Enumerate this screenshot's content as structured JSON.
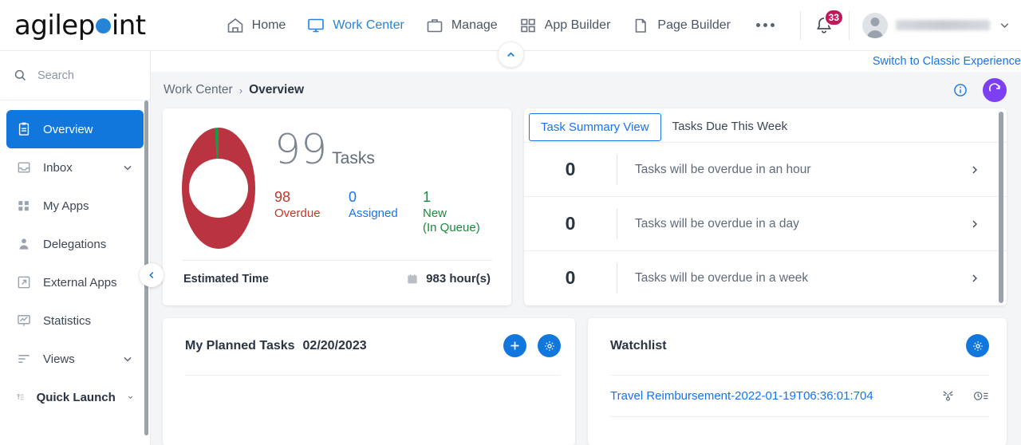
{
  "header": {
    "logo_text_pre": "agilep",
    "logo_text_post": "int",
    "logo_icon": "blue-dot",
    "nav": [
      {
        "label": "Home",
        "icon": "home-icon",
        "active": false
      },
      {
        "label": "Work Center",
        "icon": "monitor-icon",
        "active": true
      },
      {
        "label": "Manage",
        "icon": "briefcase-icon",
        "active": false
      },
      {
        "label": "App Builder",
        "icon": "grid-icon",
        "active": false
      },
      {
        "label": "Page Builder",
        "icon": "pages-icon",
        "active": false
      }
    ],
    "more_icon": "ellipsis-icon",
    "notification": {
      "icon": "bell-icon",
      "count": "33"
    },
    "user": {
      "avatar_icon": "avatar-icon",
      "name": "",
      "caret_icon": "chevron-down-icon"
    },
    "collapse_icon": "chevron-up-icon"
  },
  "sidebar": {
    "search": {
      "placeholder": "Search",
      "icon": "search-icon"
    },
    "items": [
      {
        "label": "Overview",
        "icon": "clipboard-icon",
        "active": true,
        "chevron": false
      },
      {
        "label": "Inbox",
        "icon": "inbox-icon",
        "active": false,
        "chevron": true
      },
      {
        "label": "My Apps",
        "icon": "apps-grid-icon",
        "active": false,
        "chevron": false
      },
      {
        "label": "Delegations",
        "icon": "person-icon",
        "active": false,
        "chevron": false
      },
      {
        "label": "External Apps",
        "icon": "external-link-icon",
        "active": false,
        "chevron": false
      },
      {
        "label": "Statistics",
        "icon": "chart-icon",
        "active": false,
        "chevron": false
      },
      {
        "label": "Views",
        "icon": "list-lines-icon",
        "active": false,
        "chevron": true
      },
      {
        "label": "Quick Launch",
        "icon": "quick-launch-icon",
        "active": false,
        "chevron": true
      }
    ],
    "collapse_icon": "chevron-left-icon"
  },
  "topbar": {
    "switch_link": "Switch to Classic Experience",
    "info_icon": "info-icon",
    "refresh_icon": "refresh-icon"
  },
  "breadcrumb": {
    "root": "Work Center",
    "separator": "›",
    "current": "Overview"
  },
  "tasks_card": {
    "total": "99",
    "total_label": "Tasks",
    "stats": [
      {
        "value": "98",
        "label": "Overdue",
        "color": "#c0392b"
      },
      {
        "value": "0",
        "label": "Assigned",
        "color": "#1a73e8"
      },
      {
        "value": "1",
        "label": "New\n(In Queue)",
        "color": "#188a3e"
      }
    ],
    "estimated_time_label": "Estimated Time",
    "estimated_time_value": "983 hour(s)",
    "estimated_time_icon": "calendar-icon"
  },
  "chart_data": {
    "type": "pie",
    "title": "Tasks",
    "categories": [
      "Overdue",
      "Assigned",
      "New (In Queue)"
    ],
    "values": [
      98,
      0,
      1
    ],
    "colors": [
      "#b93340",
      "#1a73e8",
      "#159b43"
    ],
    "total": 99,
    "legend": "right",
    "donut": true
  },
  "summary_card": {
    "tabs": [
      {
        "label": "Task Summary View",
        "active": true
      },
      {
        "label": "Tasks Due This Week",
        "active": false
      }
    ],
    "rows": [
      {
        "count": "0",
        "text": "Tasks will be overdue in an hour",
        "chevron": "chevron-right-icon"
      },
      {
        "count": "0",
        "text": "Tasks will be overdue in a day",
        "chevron": "chevron-right-icon"
      },
      {
        "count": "0",
        "text": "Tasks will be overdue in a week",
        "chevron": "chevron-right-icon"
      }
    ]
  },
  "planned_card": {
    "title": "My Planned Tasks",
    "date": "02/20/2023",
    "add_icon": "plus-icon",
    "settings_icon": "gear-icon"
  },
  "watchlist_card": {
    "title": "Watchlist",
    "settings_icon": "gear-icon",
    "items": [
      {
        "name": "Travel Reimbursement-2022-01-19T06:36:01:704",
        "process_icon": "process-diagram-icon",
        "history_icon": "clock-history-icon"
      }
    ]
  }
}
